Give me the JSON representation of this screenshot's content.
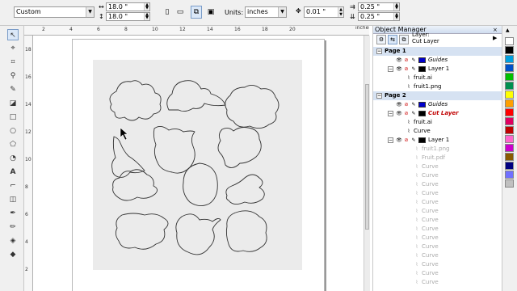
{
  "propbar": {
    "preset": "Custom",
    "width": "18.0 \"",
    "height": "18.0 \"",
    "units_label": "Units:",
    "units": "inches",
    "nudge": "0.01 \"",
    "dup_x": "0.25 \"",
    "dup_y": "0.25 \""
  },
  "ruler": {
    "top_unit": "inches",
    "top_ticks": [
      "2",
      "4",
      "6",
      "8",
      "10",
      "12",
      "14",
      "16",
      "18",
      "20"
    ],
    "left_ticks": [
      "18",
      "16",
      "14",
      "12",
      "10",
      "8",
      "6",
      "4",
      "2"
    ]
  },
  "docker": {
    "title": "Object Manager",
    "layer_label": "Layer:",
    "layer_value": "Cut Layer",
    "tree": [
      {
        "label": "Page 1",
        "kind": "page"
      },
      {
        "label": "Guides",
        "kind": "guides",
        "swatch": "#0000cc"
      },
      {
        "label": "Layer 1",
        "kind": "layer",
        "swatch": "#000000"
      },
      {
        "label": "fruit.ai",
        "kind": "item"
      },
      {
        "label": "fruit1.png",
        "kind": "item"
      },
      {
        "label": "Page 2",
        "kind": "page"
      },
      {
        "label": "Guides",
        "kind": "guides",
        "swatch": "#0000cc"
      },
      {
        "label": "Cut Layer",
        "kind": "cutlayer",
        "swatch": "#000000"
      },
      {
        "label": "fruit.ai",
        "kind": "item"
      },
      {
        "label": "Curve",
        "kind": "item"
      },
      {
        "label": "Layer 1",
        "kind": "layer",
        "swatch": "#000000"
      },
      {
        "label": "fruit1.png",
        "kind": "faded"
      },
      {
        "label": "Fruit.pdf",
        "kind": "faded"
      },
      {
        "label": "Curve",
        "kind": "faded"
      },
      {
        "label": "Curve",
        "kind": "faded"
      },
      {
        "label": "Curve",
        "kind": "faded"
      },
      {
        "label": "Curve",
        "kind": "faded"
      },
      {
        "label": "Curve",
        "kind": "faded"
      },
      {
        "label": "Curve",
        "kind": "faded"
      },
      {
        "label": "Curve",
        "kind": "faded"
      },
      {
        "label": "Curve",
        "kind": "faded"
      },
      {
        "label": "Curve",
        "kind": "faded"
      },
      {
        "label": "Curve",
        "kind": "faded"
      },
      {
        "label": "Curve",
        "kind": "faded"
      },
      {
        "label": "Curve",
        "kind": "faded"
      },
      {
        "label": "Curve",
        "kind": "faded"
      },
      {
        "label": "Curve",
        "kind": "faded"
      }
    ]
  },
  "palette": [
    "#ffffff",
    "#000000",
    "#00a0e0",
    "#0050c8",
    "#00c000",
    "#009050",
    "#ffff00",
    "#ffa000",
    "#ff0000",
    "#e00060",
    "#c00000",
    "#ff66cc",
    "#cc00cc",
    "#8a5a00",
    "#000080",
    "#7070ff",
    "#c0c0c0"
  ]
}
